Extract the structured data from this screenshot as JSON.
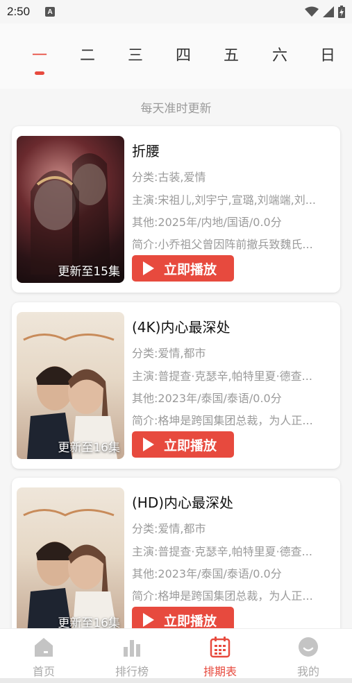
{
  "status": {
    "time": "2:50"
  },
  "weekdays": [
    "一",
    "二",
    "三",
    "四",
    "五",
    "六",
    "日"
  ],
  "subtitle": "每天准时更新",
  "cards": [
    {
      "title": "折腰",
      "category": "分类:古装,爱情",
      "cast": "主演:宋祖儿,刘宇宁,宣璐,刘端端,刘...",
      "other": "其他:2025年/内地/国语/0.0分",
      "intro": "简介:小乔祖父曾因阵前撤兵致魏氏...",
      "update": "更新至15集",
      "play": "立即播放"
    },
    {
      "title": "(4K)内心最深处",
      "category": "分类:爱情,都市",
      "cast": "主演:普提查·克瑟辛,帕特里夏·德查...",
      "other": "其他:2023年/泰国/泰语/0.0分",
      "intro": "简介:格坤是跨国集团总裁，为人正...",
      "update": "更新至16集",
      "play": "立即播放"
    },
    {
      "title": "(HD)内心最深处",
      "category": "分类:爱情,都市",
      "cast": "主演:普提查·克瑟辛,帕特里夏·德查...",
      "other": "其他:2023年/泰国/泰语/0.0分",
      "intro": "简介:格坤是跨国集团总裁，为人正...",
      "update": "更新至16集",
      "play": "立即播放"
    }
  ],
  "tabs": [
    {
      "label": "首页",
      "icon": "home-icon"
    },
    {
      "label": "排行榜",
      "icon": "bar-chart-icon"
    },
    {
      "label": "排期表",
      "icon": "calendar-icon"
    },
    {
      "label": "我的",
      "icon": "profile-icon"
    }
  ],
  "colors": {
    "accent": "#e74a3e",
    "inactive": "#aaaaaa"
  }
}
